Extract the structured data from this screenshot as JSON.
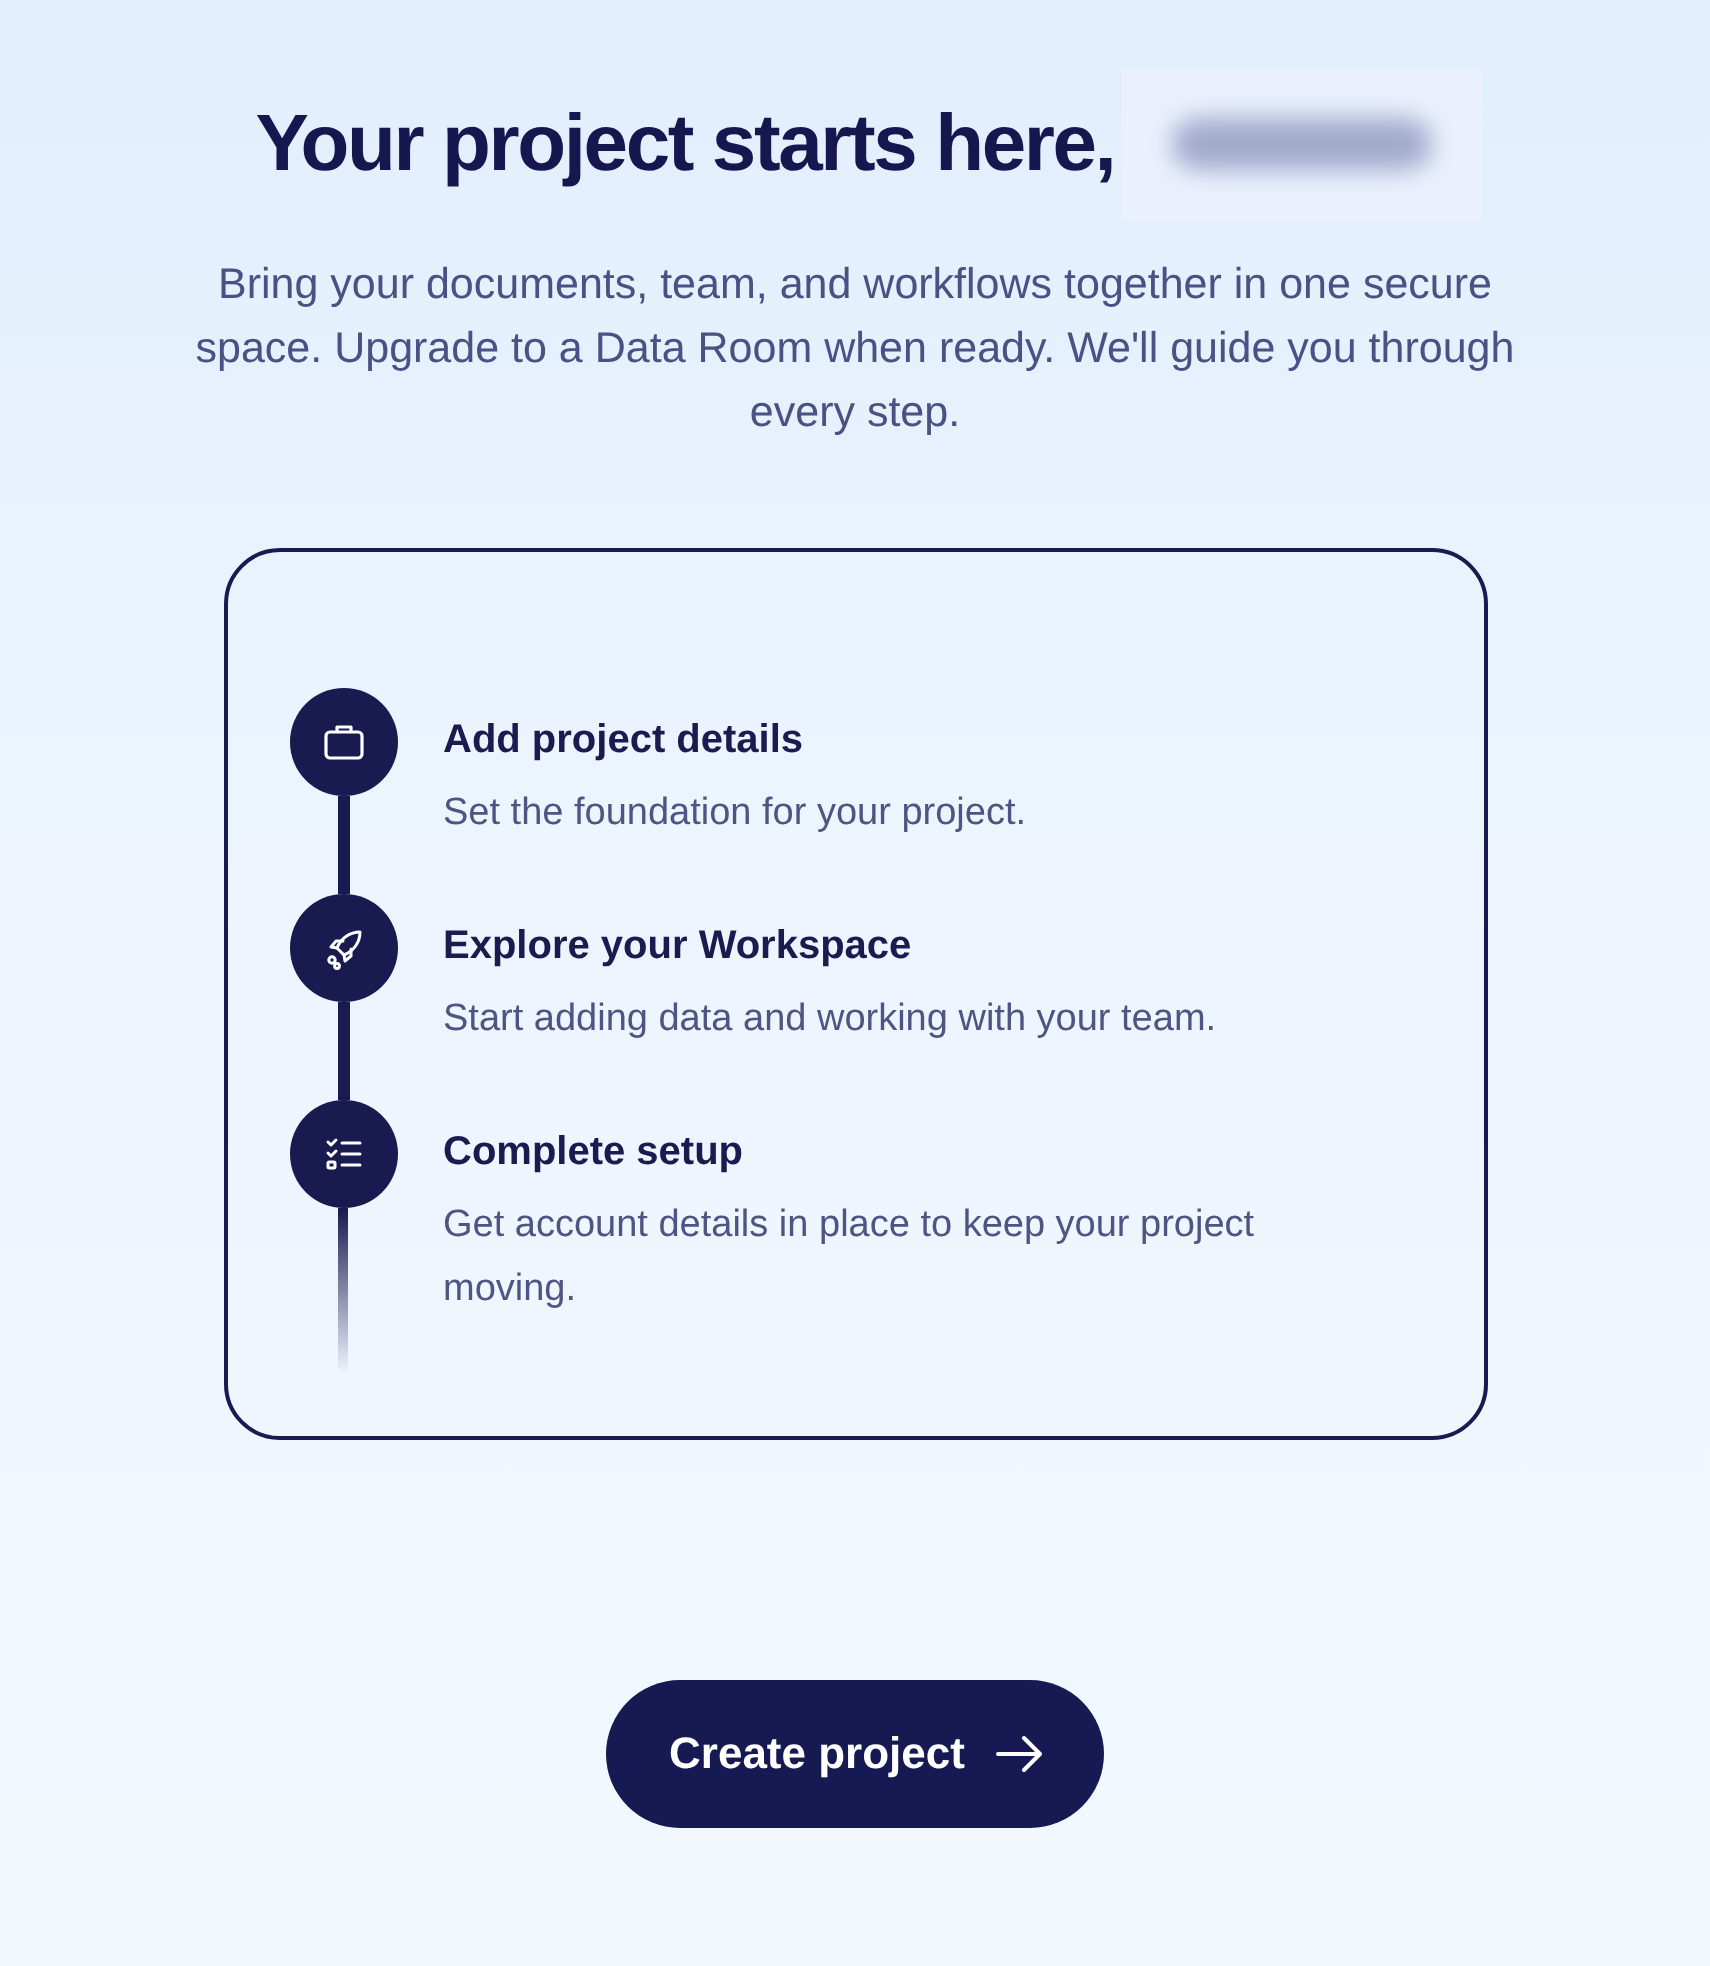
{
  "heading": {
    "text": "Your project starts here,",
    "name_redacted": true
  },
  "intro": "Bring your documents, team, and workflows together in one secure space. Upgrade to a Data Room when ready. We'll guide you through every step.",
  "steps": [
    {
      "title": "Add project details",
      "description": "Set the foundation for your project."
    },
    {
      "title": "Explore your Workspace",
      "description": "Start adding data and working with your team."
    },
    {
      "title": "Complete setup",
      "description": "Get account details in place to keep your project moving."
    }
  ],
  "button": {
    "label": "Create project"
  }
}
